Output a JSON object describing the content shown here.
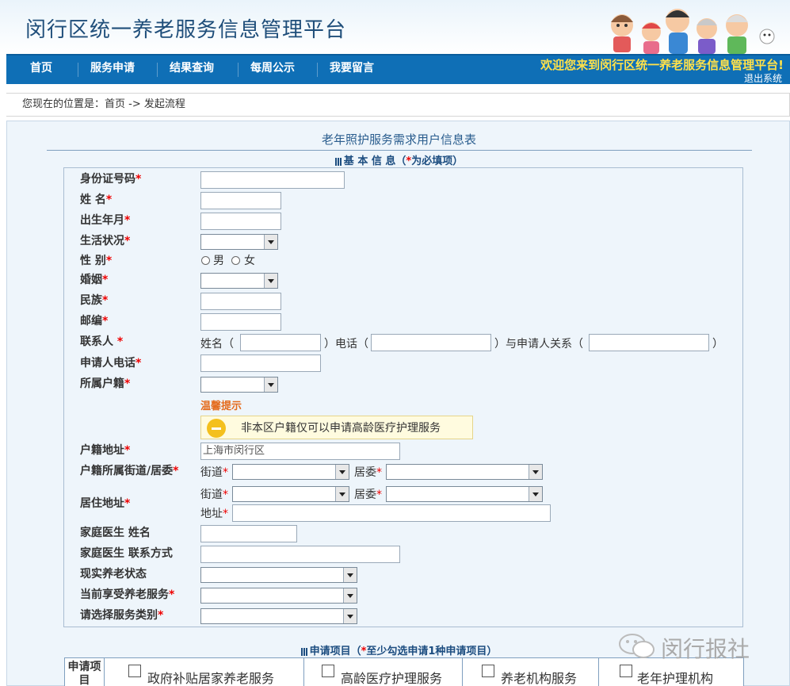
{
  "header": {
    "title": "闵行区统一养老服务信息管理平台"
  },
  "nav": {
    "items": [
      "首页",
      "服务申请",
      "结果查询",
      "每周公示",
      "我要留言"
    ],
    "welcome": "欢迎您来到闵行区统一养老服务信息管理平台!",
    "logout": "退出系统"
  },
  "breadcrumb": "您现在的位置是：首页 -> 发起流程",
  "form": {
    "title": "老年照护服务需求用户信息表",
    "basic_section": {
      "prefix": "基 本 信 息（",
      "star": "*",
      "suffix": "为必填项）"
    },
    "labels": {
      "id": "身份证号码",
      "name": "姓 名",
      "birth": "出生年月",
      "living": "生活状况",
      "gender": "性 别",
      "marriage": "婚姻",
      "ethnicity": "民族",
      "postcode": "邮编",
      "contact": "联系人 ",
      "applicant_phone": "申请人电话",
      "household": "所属户籍",
      "hukou_addr": "户籍地址",
      "hukou_street": "户籍所属街道/居委",
      "residence": "居住地址",
      "doctor_name": "家庭医生 姓名",
      "doctor_contact": "家庭医生 联系方式",
      "care_status": "现实养老状态",
      "current_service": "当前享受养老服务",
      "service_category": "请选择服务类别"
    },
    "req_mark": "*",
    "gender_options": {
      "male": "男",
      "female": "女"
    },
    "contact_fields": {
      "name_open": "姓名（",
      "phone_open": "）电话（",
      "relation_open": "）与申请人关系（",
      "close": "）"
    },
    "hint": {
      "title": "温馨提示",
      "text": "非本区户籍仅可以申请高龄医疗护理服务"
    },
    "hukou_address_value": "上海市闵行区",
    "street_label": "街道",
    "committee_label": "居委",
    "address_label": "地址"
  },
  "projects": {
    "section": {
      "prefix": "申请项目（",
      "star": "*",
      "suffix": "至少勾选申请1种申请项目）"
    },
    "head": "申请项目",
    "items": [
      "政府补贴居家养老服务",
      "高龄医疗护理服务",
      "养老机构服务",
      "老年护理机构"
    ]
  },
  "watermark": "闵行报社",
  "colors": {
    "nav": "#0f6fb6",
    "welcome": "#ffe14a",
    "required": "#e00000",
    "hint": "#e46b1c"
  }
}
